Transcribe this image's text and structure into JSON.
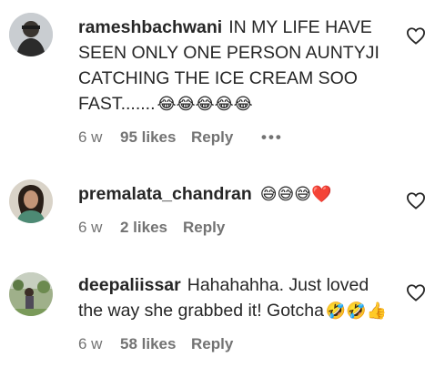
{
  "comments": [
    {
      "username": "rameshbachwani",
      "text": "IN MY LIFE HAVE SEEN ONLY ONE PERSON AUNTYJI CATCHING THE ICE CREAM SOO FAST.......",
      "emojis": "😂😂😂😂😂",
      "age": "6 w",
      "likes": "95 likes",
      "reply": "Reply",
      "more": "•••"
    },
    {
      "username": "premalata_chandran",
      "text": "",
      "emojis": "😅😅😅❤️",
      "age": "6 w",
      "likes": "2 likes",
      "reply": "Reply"
    },
    {
      "username": "deepaliissar",
      "text": "Hahahahha. Just loved the way she grabbed it! Gotcha",
      "emojis": "🤣🤣👍",
      "age": "6 w",
      "likes": "58 likes",
      "reply": "Reply"
    }
  ],
  "icons": {
    "like": "heart-outline-icon",
    "more": "more-options-icon"
  },
  "colors": {
    "text": "#262626",
    "secondary": "#737373"
  }
}
